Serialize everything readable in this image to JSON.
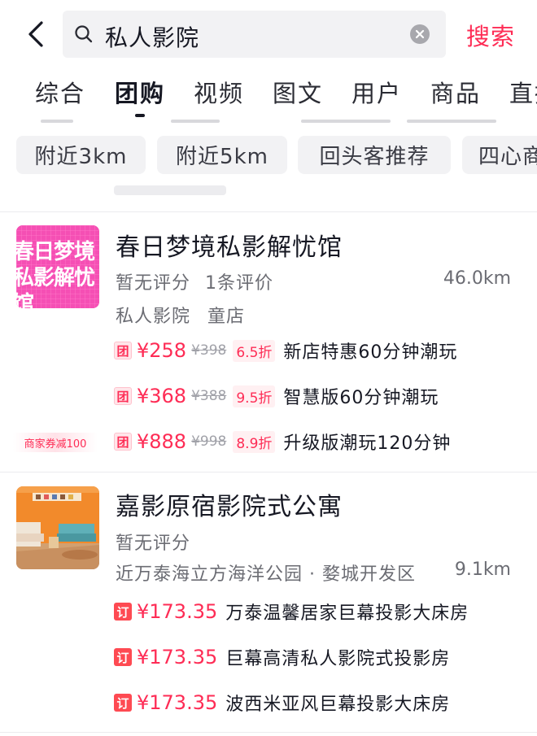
{
  "search": {
    "query": "私人影院",
    "button_label": "搜索"
  },
  "tabs": [
    {
      "label": "综合",
      "active": false
    },
    {
      "label": "团购",
      "active": true
    },
    {
      "label": "视频",
      "active": false
    },
    {
      "label": "图文",
      "active": false
    },
    {
      "label": "用户",
      "active": false
    },
    {
      "label": "商品",
      "active": false
    },
    {
      "label": "直播",
      "active": false
    }
  ],
  "filters": [
    "附近3km",
    "附近5km",
    "回头客推荐",
    "四心商家"
  ],
  "shops": [
    {
      "thumb_text": "春日梦境私影解忧馆",
      "name": "春日梦境私影解忧馆",
      "rating": "暂无评分",
      "reviews": "1条评价",
      "distance": "46.0km",
      "category": "私人影院",
      "area": "童店",
      "coupon_tag": "商家券减100",
      "deals": [
        {
          "icon": "团",
          "price": "¥258",
          "original": "¥398",
          "discount": "6.5折",
          "title": "新店特惠60分钟潮玩"
        },
        {
          "icon": "团",
          "price": "¥368",
          "original": "¥388",
          "discount": "9.5折",
          "title": "智慧版60分钟潮玩"
        },
        {
          "icon": "团",
          "price": "¥888",
          "original": "¥998",
          "discount": "8.9折",
          "title": "升级版潮玩120分钟"
        }
      ]
    },
    {
      "name": "嘉影原宿影院式公寓",
      "rating": "暂无评分",
      "location": "近万泰海立方海洋公园 · 婺城开发区",
      "distance": "9.1km",
      "deals": [
        {
          "icon": "订",
          "price": "¥173.35",
          "title": "万泰温馨居家巨幕投影大床房"
        },
        {
          "icon": "订",
          "price": "¥173.35",
          "title": "巨幕高清私人影院式投影房"
        },
        {
          "icon": "订",
          "price": "¥173.35",
          "title": "波西米亚风巨幕投影大床房"
        }
      ]
    }
  ],
  "colors": {
    "accent": "#fe2c55",
    "text": "#161823",
    "secondary": "#6b6c73",
    "chip_bg": "#f2f2f4"
  }
}
